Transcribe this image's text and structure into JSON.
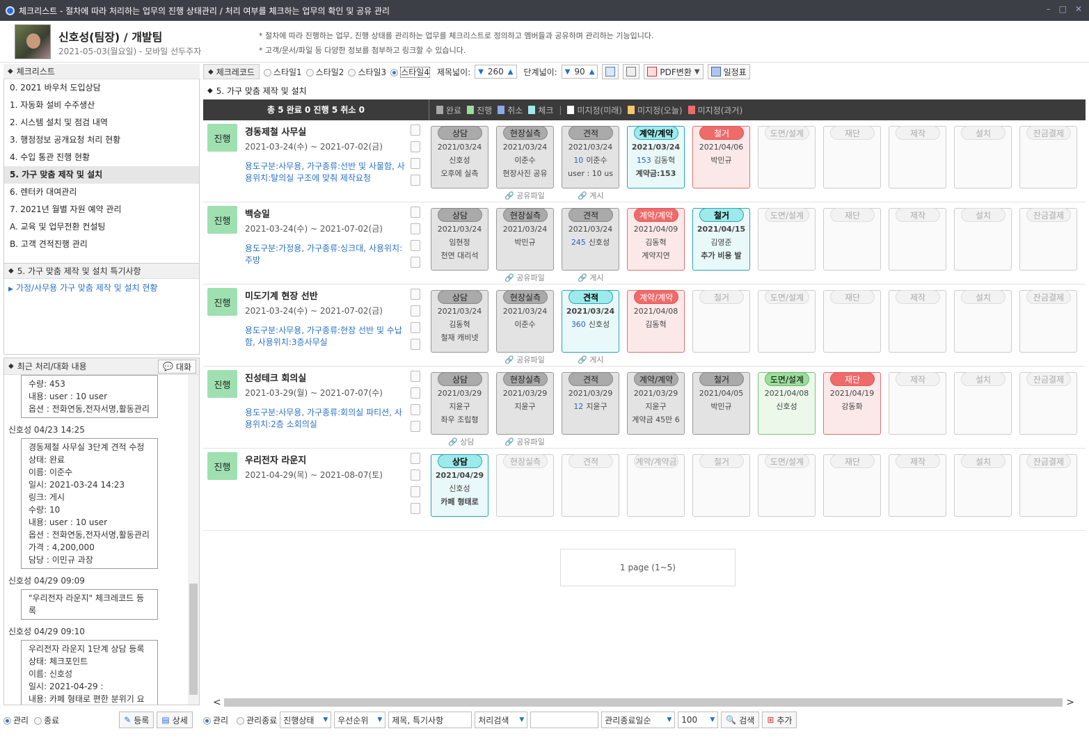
{
  "window": {
    "title": "체크리스트 - 절차에 따라 처리하는 업무의 진행 상태관리 / 처리 여부를 체크하는 업무의 확인 및 공유 관리"
  },
  "user": {
    "name": "신호성(팀장) / 개발팀",
    "date": "2021-05-03(월요일) - 모바일 선두주자"
  },
  "notes": [
    "* 절차에 따라 진행하는 업무, 진행 상태를 관리하는 업무를 체크리스트로 정의하고 멤버들과 공유하며 관리하는 기능입니다.",
    "* 고객/문서/파일 등 다양한 정보를 첨부하고 링크할 수 있습니다."
  ],
  "checklist": {
    "header": "체크리스트",
    "items": [
      "0. 2021 바우처 도입상담",
      "1. 자동화 설비 수주생산",
      "2. 시스템 설치 및 점검 내역",
      "3. 행정정보 공개요청 처리 현황",
      "4. 수입 통관 진행 현황",
      "5. 가구 맞춤 제작 및 설치",
      "6. 렌터카 대여관리",
      "7. 2021년 월별 자원 예약 관리",
      "A. 교육 및 업무전환 컨설팅",
      "B. 고객 견적진행 관리"
    ]
  },
  "special": {
    "header": "5. 가구 맞춤 제작 및 설치 특기사항",
    "link": "가정/사무용 가구 맞춤 제작 및 설치 현황"
  },
  "chat": {
    "header": "최근 처리/대화 내용",
    "button": "대화",
    "msgs": [
      {
        "who": "",
        "lines": [
          "수량: 453",
          "내용: user : 10 user",
          "옵션 : 전화연동,전자서명,활동관리"
        ]
      },
      {
        "who": "신호성   04/23 14:25",
        "lines": [
          "경동제철 사무실 3단계 견적 수정",
          "상태: 완료",
          "이름: 이준수",
          "일시: 2021-03-24 14:23",
          "링크: 게시",
          "수량: 10",
          "내용: user : 10 user",
          "옵션 : 전화연동,전자서명,활동관리",
          "가격 : 4,200,000",
          "담당 : 이민규 과장"
        ]
      },
      {
        "who": "신호성   04/29 09:09",
        "lines": [
          "\"우리전자 라운지\" 체크레코드 등록"
        ]
      },
      {
        "who": "신호성   04/29 09:10",
        "lines": [
          "우리전자 라운지 1단계 상담 등록",
          "상태: 체크포인트",
          "이름: 신호성",
          "일시: 2021-04-29    :",
          "내용: 카페 형태로 편한 분위기 요청"
        ]
      }
    ]
  },
  "leftbar": {
    "r1": "관리",
    "r2": "종료",
    "reg": "등록",
    "detail": "상세"
  },
  "toolbar": {
    "tab": "체크레코드",
    "styles": [
      "스타일1",
      "스타일2",
      "스타일3",
      "스타일4"
    ],
    "title_w_label": "제목넓이:",
    "title_w": "260",
    "step_w_label": "단계넓이:",
    "step_w": "90",
    "pdf": "PDF변환",
    "schedule": "일정표"
  },
  "section": {
    "title": "5. 가구 맞춤 제작 및 설치"
  },
  "stats": {
    "total": "총 5  완료 0  진행 5  취소 0",
    "legend": [
      {
        "label": "완료",
        "color": "#a8a8a8"
      },
      {
        "label": "진행",
        "color": "#9bde9a"
      },
      {
        "label": "취소",
        "color": "#8fa8e8"
      },
      {
        "label": "체크",
        "color": "#9eeaea"
      },
      {
        "label": "미지정(미래)",
        "color": "#ffffff"
      },
      {
        "label": "미지정(오늘)",
        "color": "#f6c66b"
      },
      {
        "label": "미지정(과거)",
        "color": "#ef6b6b"
      }
    ]
  },
  "rows": [
    {
      "badge": "진행",
      "title": "경동제철 사무실",
      "date": "2021-03-24(수) ~ 2021-07-02(금)",
      "desc": "용도구분:사무용, 가구종류:선반 및 사물함, 사용위치:탈의실 구조에 맞춰 제작요청",
      "shared1": "공유파일",
      "shared2": "게시",
      "steps": [
        {
          "name": "상담",
          "st": "gray",
          "l1": "2021/03/24",
          "l2": "신호성",
          "l3": "오후에 실측"
        },
        {
          "name": "현장실측",
          "st": "gray",
          "l1": "2021/03/24",
          "l2": "이준수",
          "l3": "현장사진 공유"
        },
        {
          "name": "견적",
          "st": "gray",
          "l1": "2021/03/24",
          "num": "10",
          "l2": "이준수",
          "l3": "user : 10 us"
        },
        {
          "name": "계약/계약",
          "st": "cyan",
          "l1": "2021/03/24",
          "num": "153",
          "l2": "김동혁",
          "l3": "계약금:153"
        },
        {
          "name": "철거",
          "st": "red",
          "l1": "2021/04/06",
          "l2": "박민규",
          "l3": ""
        },
        {
          "name": "도면/설계",
          "st": "empty"
        },
        {
          "name": "재단",
          "st": "empty"
        },
        {
          "name": "제작",
          "st": "empty"
        },
        {
          "name": "설치",
          "st": "empty"
        },
        {
          "name": "잔금결제",
          "st": "empty"
        }
      ]
    },
    {
      "badge": "진행",
      "title": "백승일",
      "date": "2021-03-24(수) ~ 2021-07-02(금)",
      "desc": "용도구분:가정용, 가구종류:싱크대, 사용위치:주방",
      "shared1": "공유파일",
      "shared2": "게시",
      "steps": [
        {
          "name": "상담",
          "st": "gray",
          "l1": "2021/03/24",
          "l2": "임현정",
          "l3": "천연 대리석"
        },
        {
          "name": "현장실측",
          "st": "gray",
          "l1": "2021/03/24",
          "l2": "박민규",
          "l3": ""
        },
        {
          "name": "견적",
          "st": "gray",
          "l1": "2021/03/24",
          "num": "245",
          "l2": "신호성",
          "l3": ""
        },
        {
          "name": "계약/계약",
          "st": "red",
          "l1": "2021/04/09",
          "l2": "김동혁",
          "l3": "계약지연"
        },
        {
          "name": "철거",
          "st": "cyan",
          "l1": "2021/04/15",
          "l2": "김영준",
          "l3": "추가 비용 발"
        },
        {
          "name": "도면/설계",
          "st": "empty"
        },
        {
          "name": "재단",
          "st": "empty"
        },
        {
          "name": "제작",
          "st": "empty"
        },
        {
          "name": "설치",
          "st": "empty"
        },
        {
          "name": "잔금결제",
          "st": "empty"
        }
      ]
    },
    {
      "badge": "진행",
      "title": "미도기계 현장 선반",
      "date": "2021-03-24(수) ~ 2021-07-02(금)",
      "desc": "용도구분:사무용, 가구종류:현장 선반 및 수납함, 사용위치:3층사무실",
      "shared1": "공유파일",
      "shared2": "게시",
      "steps": [
        {
          "name": "상담",
          "st": "gray",
          "l1": "2021/03/24",
          "l2": "김동혁",
          "l3": "철재 캐비넷"
        },
        {
          "name": "현장실측",
          "st": "gray",
          "l1": "2021/03/24",
          "l2": "이준수",
          "l3": ""
        },
        {
          "name": "견적",
          "st": "cyan",
          "l1": "2021/03/24",
          "num": "360",
          "l2": "신호성",
          "l3": ""
        },
        {
          "name": "계약/계약",
          "st": "red",
          "l1": "2021/04/08",
          "l2": "김동혁",
          "l3": ""
        },
        {
          "name": "철거",
          "st": "empty"
        },
        {
          "name": "도면/설계",
          "st": "empty"
        },
        {
          "name": "재단",
          "st": "empty"
        },
        {
          "name": "제작",
          "st": "empty"
        },
        {
          "name": "설치",
          "st": "empty"
        },
        {
          "name": "잔금결제",
          "st": "empty"
        }
      ]
    },
    {
      "badge": "진행",
      "title": "진성테크 회의실",
      "date": "2021-03-29(월) ~ 2021-07-07(수)",
      "desc": "용도구분:사무용, 가구종류:회의실 파티션, 사용위치:2층 소회의실",
      "shared1": "상담",
      "shared2": "공유파일",
      "steps": [
        {
          "name": "상담",
          "st": "gray",
          "l1": "2021/03/29",
          "l2": "지윤구",
          "l3": "좌우 조립형"
        },
        {
          "name": "현장실측",
          "st": "gray",
          "l1": "2021/03/29",
          "l2": "지윤구",
          "l3": ""
        },
        {
          "name": "견적",
          "st": "gray",
          "l1": "2021/03/29",
          "num": "12",
          "l2": "지윤구",
          "l3": ""
        },
        {
          "name": "계약/계약",
          "st": "gray",
          "l1": "2021/03/29",
          "l2": "지윤구",
          "l3": "계약금 45만 6"
        },
        {
          "name": "철거",
          "st": "gray",
          "l1": "2021/04/05",
          "l2": "박민규",
          "l3": ""
        },
        {
          "name": "도면/설계",
          "st": "green",
          "l1": "2021/04/08",
          "l2": "신호성",
          "l3": ""
        },
        {
          "name": "재단",
          "st": "red",
          "l1": "2021/04/19",
          "l2": "강동화",
          "l3": ""
        },
        {
          "name": "제작",
          "st": "empty"
        },
        {
          "name": "설치",
          "st": "empty"
        },
        {
          "name": "잔금결제",
          "st": "empty"
        }
      ]
    },
    {
      "badge": "진행",
      "title": "우리전자 라운지",
      "date": "2021-04-29(목) ~ 2021-08-07(토)",
      "desc": "",
      "shared1": "",
      "shared2": "",
      "steps": [
        {
          "name": "상담",
          "st": "cyan",
          "l1": "2021/04/29",
          "l2": "신호성",
          "l3": "카페 형태로"
        },
        {
          "name": "현장실측",
          "st": "empty"
        },
        {
          "name": "견적",
          "st": "empty"
        },
        {
          "name": "계약/계약금",
          "st": "empty"
        },
        {
          "name": "철거",
          "st": "empty"
        },
        {
          "name": "도면/설계",
          "st": "empty"
        },
        {
          "name": "재단",
          "st": "empty"
        },
        {
          "name": "제작",
          "st": "empty"
        },
        {
          "name": "설치",
          "st": "empty"
        },
        {
          "name": "잔금결제",
          "st": "empty"
        }
      ]
    }
  ],
  "pager": "1 page (1~5)",
  "bottom": {
    "r1": "관리",
    "r2": "관리종료",
    "dd1": "진행상태",
    "dd2": "우선순위",
    "search": "제목, 특기사항",
    "dd3": "처리검색",
    "dd4": "관리종료일순",
    "count": "100",
    "search_btn": "검색",
    "add_btn": "추가"
  }
}
